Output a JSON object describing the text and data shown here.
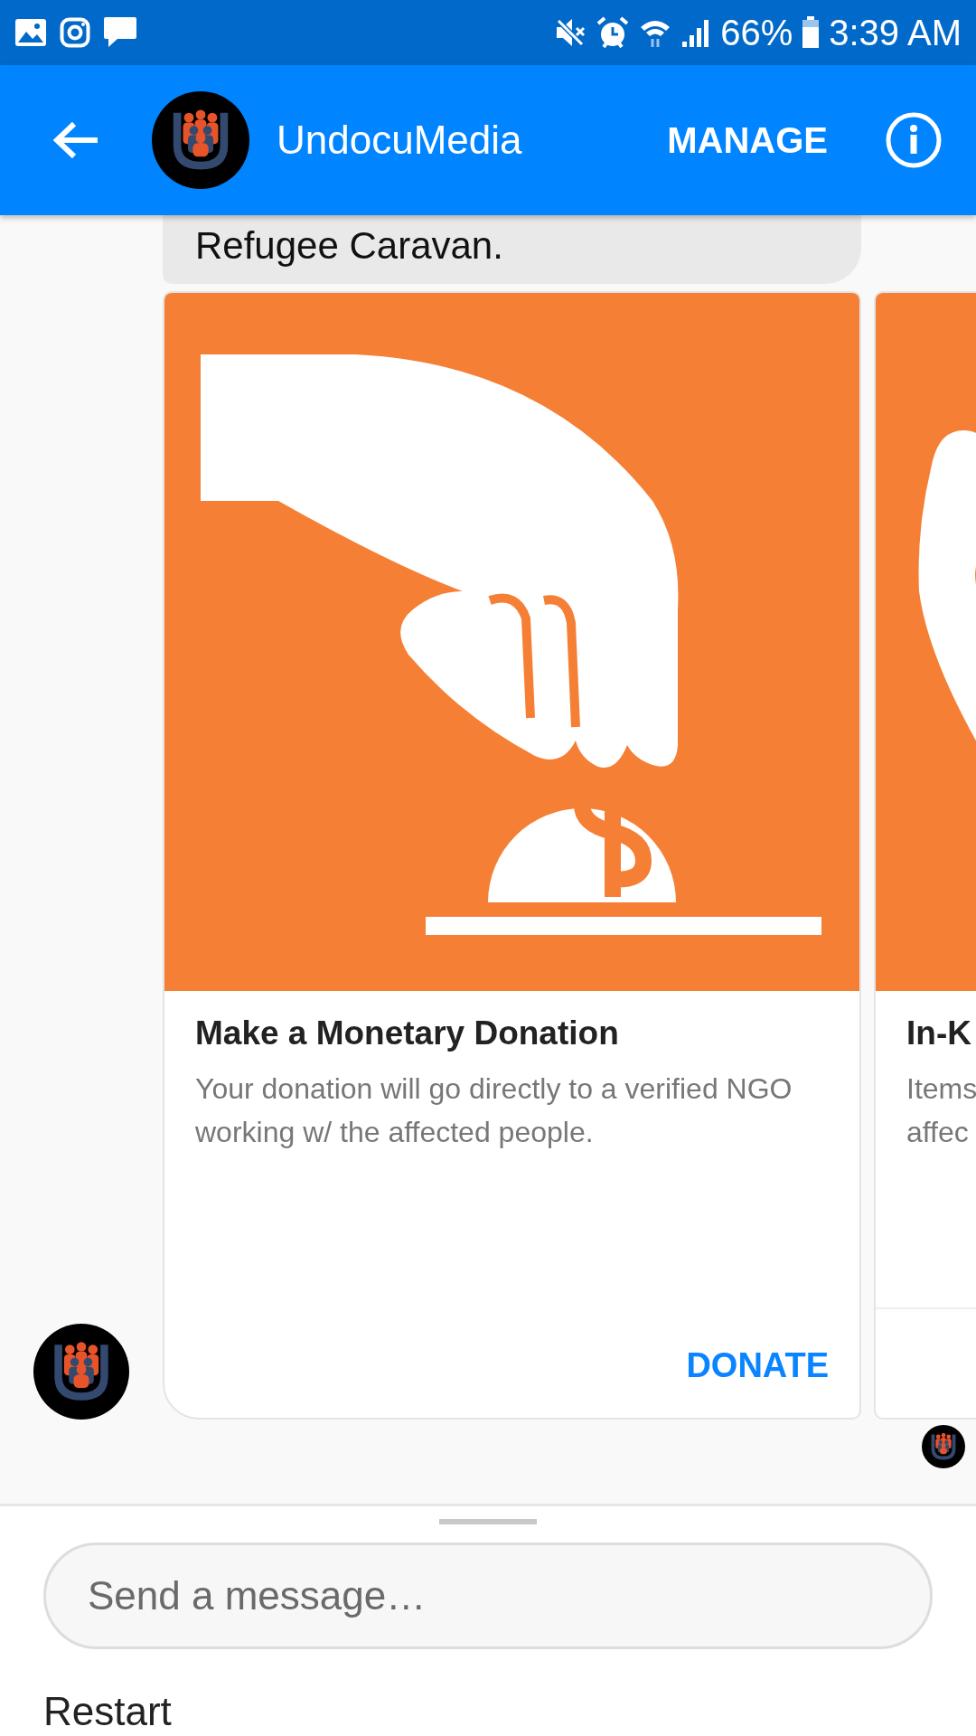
{
  "status_bar": {
    "battery": "66%",
    "time": "3:39 AM"
  },
  "header": {
    "title": "UndocuMedia",
    "action": "MANAGE"
  },
  "message": {
    "text": "Refugee Caravan."
  },
  "cards": [
    {
      "kind": "full",
      "title": "Make a Monetary Donation",
      "subtitle": "Your donation will go directly to a verified NGO working w/ the affected people.",
      "button": "DONATE"
    },
    {
      "kind": "partial",
      "title": "In-K",
      "subtitle": "Items affec"
    }
  ],
  "composer": {
    "placeholder": "Send a message…"
  },
  "quick_reply": "Restart"
}
